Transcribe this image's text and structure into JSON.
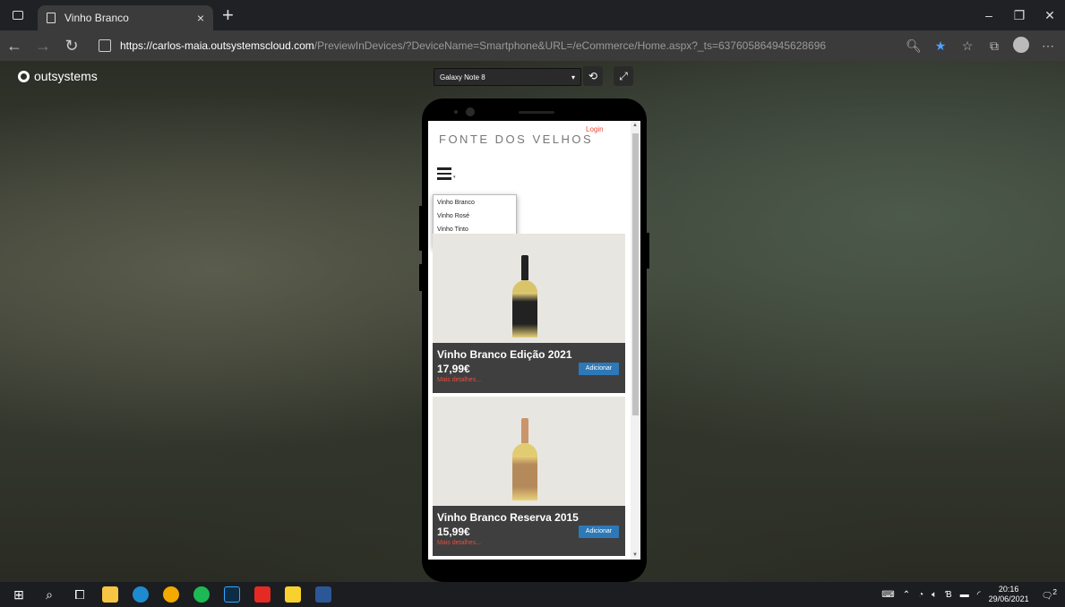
{
  "browser": {
    "tab_title": "Vinho Branco",
    "tab_close": "×",
    "new_tab": "+",
    "url_host": "https://carlos-maia.outsystemscloud.com",
    "url_path": "/PreviewInDevices/?DeviceName=Smartphone&URL=/eCommerce/Home.aspx?_ts=637605864945628696",
    "window_controls": [
      "–",
      "❐",
      "✕"
    ]
  },
  "preview": {
    "logo_text": "outsystems",
    "device_name": "Galaxy Note 8"
  },
  "site": {
    "brand": "FONTE DOS VELHOS",
    "login": "Login",
    "menu_items": [
      "Vinho Branco",
      "Vinho Rosé",
      "Vinho Tinto"
    ],
    "products": [
      {
        "name": "Vinho Branco Edição 2021",
        "price": "17,99€",
        "details": "Mais detalhes...",
        "add_label": "Adicionar",
        "label_color": "#222222"
      },
      {
        "name": "Vinho Branco Reserva 2015",
        "price": "15,99€",
        "details": "Mais detalhes...",
        "add_label": "Adicionar",
        "label_color": "#b58a5a"
      }
    ]
  },
  "taskbar": {
    "time": "20:16",
    "date": "29/06/2021",
    "notification_count": "2"
  },
  "colors": {
    "accent": "#2d79b8",
    "link_red": "#e84c3d",
    "wine_color": "#e9d27a"
  }
}
